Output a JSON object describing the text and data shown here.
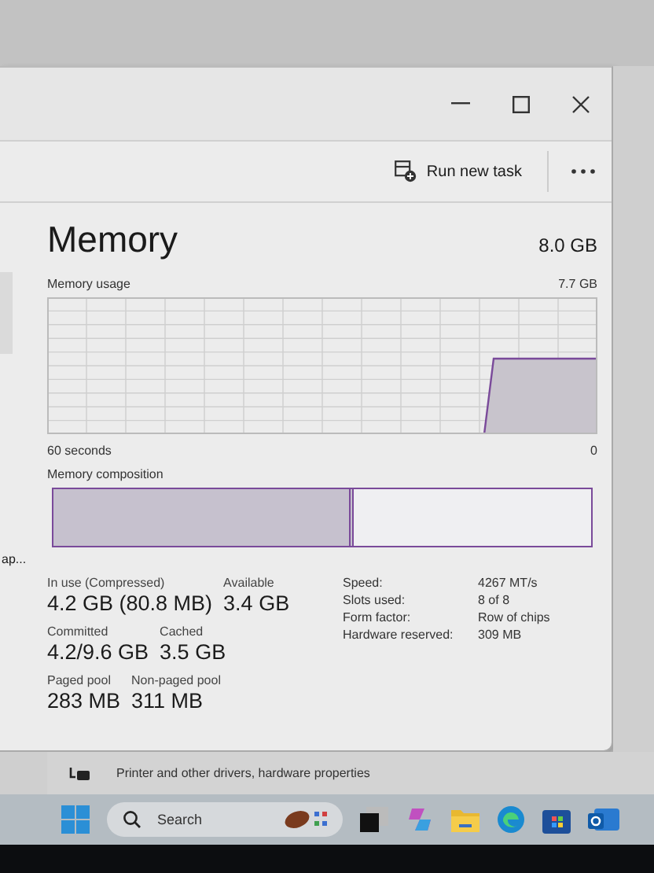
{
  "toolbar": {
    "run_new_task": "Run new task"
  },
  "memory": {
    "title": "Memory",
    "total": "8.0 GB",
    "usage_label": "Memory usage",
    "usage_value": "7.7 GB",
    "time_label": "60 seconds",
    "zero_label": "0",
    "composition_label": "Memory composition",
    "composition": {
      "level": 0.55
    }
  },
  "stats": [
    [
      {
        "label": "In use (Compressed)",
        "value": "4.2 GB (80.8 MB)"
      },
      {
        "label": "Available",
        "value": "3.4 GB"
      }
    ],
    [
      {
        "label": "Committed",
        "value": "4.2/9.6 GB"
      },
      {
        "label": "Cached",
        "value": "3.5 GB"
      }
    ],
    [
      {
        "label": "Paged pool",
        "value": "283 MB"
      },
      {
        "label": "Non-paged pool",
        "value": "311 MB"
      }
    ]
  ],
  "specs": [
    {
      "label": "Speed:",
      "value": "4267 MT/s"
    },
    {
      "label": "Slots used:",
      "value": "8 of 8"
    },
    {
      "label": "Form factor:",
      "value": "Row of chips"
    },
    {
      "label": "Hardware reserved:",
      "value": "309 MB"
    }
  ],
  "side_text": "ap...",
  "settings_row": "Printer and other drivers, hardware properties",
  "taskbar": {
    "search_placeholder": "Search"
  }
}
